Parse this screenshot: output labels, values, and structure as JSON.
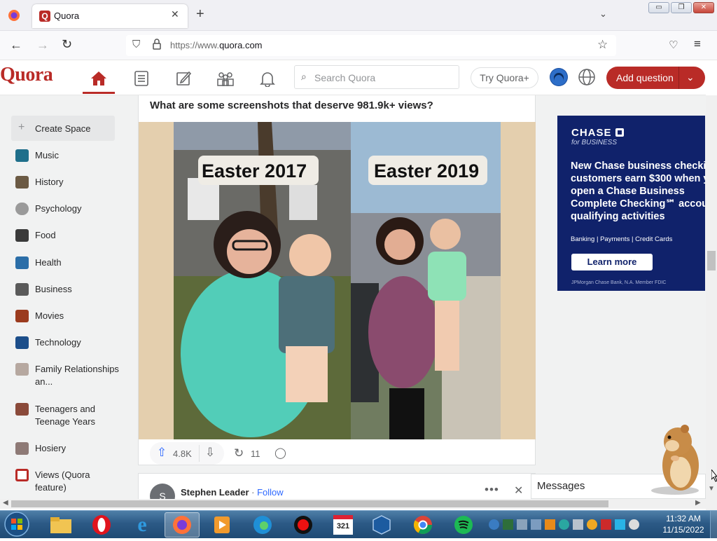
{
  "browser": {
    "tab_title": "Quora",
    "new_tab": "+",
    "url_scheme": "https://www.",
    "url_host": "quora.com",
    "window_buttons": [
      "▭",
      "❐",
      "✕"
    ]
  },
  "quora_header": {
    "logo": "Quora",
    "search_placeholder": "Search Quora",
    "try_plus": "Try Quora+",
    "add_question": "Add question"
  },
  "sidebar": {
    "items": [
      {
        "label": "Create Space",
        "icon": "plus-icon",
        "color": "#939598"
      },
      {
        "label": "Music",
        "icon": "music-space-icon",
        "color": "#1f6f8b"
      },
      {
        "label": "History",
        "icon": "history-space-icon",
        "color": "#6b5a44"
      },
      {
        "label": "Psychology",
        "icon": "psychology-space-icon",
        "color": "#9a9a9a"
      },
      {
        "label": "Food",
        "icon": "food-space-icon",
        "color": "#3a3a3a"
      },
      {
        "label": "Health",
        "icon": "health-space-icon",
        "color": "#2b6ea8"
      },
      {
        "label": "Business",
        "icon": "business-space-icon",
        "color": "#5a5a5a"
      },
      {
        "label": "Movies",
        "icon": "movies-space-icon",
        "color": "#9b3b1e"
      },
      {
        "label": "Technology",
        "icon": "technology-space-icon",
        "color": "#1c4e8a"
      },
      {
        "label": "Family Relationships an...",
        "icon": "family-space-icon",
        "color": "#b6a8a0"
      },
      {
        "label": "Teenagers and Teenage Years",
        "icon": "teenagers-space-icon",
        "color": "#8a4a3a"
      },
      {
        "label": "Hosiery",
        "icon": "hosiery-space-icon",
        "color": "#8e7a76"
      },
      {
        "label": "Views (Quora feature)",
        "icon": "views-space-icon",
        "color": "#b92b27"
      }
    ]
  },
  "post": {
    "title": "What are some screenshots that deserve 981.9k+ views?",
    "image_left_caption": "Easter 2017",
    "image_right_caption": "Easter 2019",
    "upvotes": "4.8K",
    "shares": "11"
  },
  "next_post": {
    "avatar_letter": "S",
    "author": "Stephen Leader",
    "separator": " · ",
    "follow": "Follow"
  },
  "ad": {
    "brand": "CHASE",
    "brand_sub": "for BUSINESS",
    "headline": "New Chase business checki customers earn $300 when you open a Chase Business Complete Checking℠ accou with qualifying activities",
    "links": "Banking | Payments | Credit Cards",
    "cta": "Learn more",
    "disclaimer": "JPMorgan Chase Bank, N.A. Member FDIC"
  },
  "messages": {
    "label": "Messages"
  },
  "taskbar": {
    "time": "11:32 AM",
    "date": "11/15/2022",
    "apps": [
      "start",
      "explorer",
      "opera",
      "ie",
      "firefox",
      "media",
      "edge",
      "record",
      "calendar",
      "virtualbox",
      "chrome",
      "spotify"
    ]
  },
  "colors": {
    "quora_red": "#b92b27",
    "chase_blue": "#10226b",
    "link_blue": "#2e69ff"
  }
}
